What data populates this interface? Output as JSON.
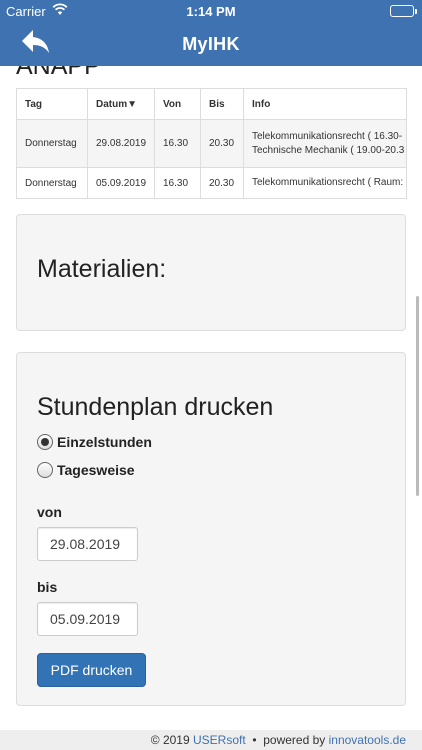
{
  "status": {
    "carrier": "Carrier",
    "time": "1:14 PM"
  },
  "nav": {
    "title": "MyIHK"
  },
  "section": {
    "cut_heading": "ANAPP"
  },
  "table": {
    "headers": {
      "tag": "Tag",
      "datum": "Datum▼",
      "von": "Von",
      "bis": "Bis",
      "info": "Info"
    },
    "rows": [
      {
        "tag": "Donnerstag",
        "datum": "29.08.2019",
        "von": "16.30",
        "bis": "20.30",
        "info1": "Telekommunikationsrecht ( 16.30-",
        "info2": "Technische Mechanik ( 19.00-20.3"
      },
      {
        "tag": "Donnerstag",
        "datum": "05.09.2019",
        "von": "16.30",
        "bis": "20.30",
        "info1": "Telekommunikationsrecht ( Raum:"
      }
    ]
  },
  "materials": {
    "title": "Materialien:"
  },
  "print": {
    "title": "Stundenplan drucken",
    "option1": "Einzelstunden",
    "option2": "Tagesweise",
    "selected": "Einzelstunden",
    "from_label": "von",
    "from_value": "29.08.2019",
    "to_label": "bis",
    "to_value": "05.09.2019",
    "button": "PDF drucken"
  },
  "footer": {
    "copyright": "© 2019",
    "company": "USERsoft",
    "separator": "•",
    "powered": "powered by",
    "partner": "innovatools.de"
  },
  "colors": {
    "accent": "#3f72b1",
    "button": "#3273b5"
  }
}
